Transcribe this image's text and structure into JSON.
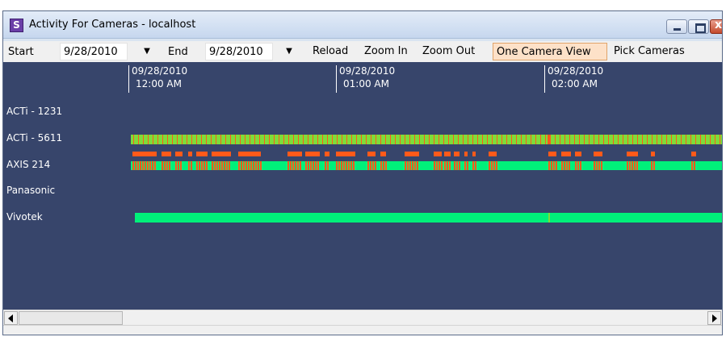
{
  "window": {
    "title": "Activity For Cameras - localhost",
    "app_icon_letter": "S"
  },
  "toolbar": {
    "start_label": "Start",
    "start_date": "9/28/2010",
    "end_label": "End",
    "end_date": "9/28/2010",
    "reload_label": "Reload",
    "zoom_in_label": "Zoom In",
    "zoom_out_label": "Zoom Out",
    "one_camera_view_label": "One Camera View",
    "pick_cameras_label": "Pick Cameras"
  },
  "timeline": {
    "ticks": [
      {
        "date": "09/28/2010",
        "time": "12:00 AM"
      },
      {
        "date": "09/28/2010",
        "time": "01:00 AM"
      },
      {
        "date": "09/28/2010",
        "time": "02:00 AM"
      }
    ],
    "cameras": [
      {
        "name": "ACTi - 1231"
      },
      {
        "name": "ACTi - 5611"
      },
      {
        "name": "AXIS 214"
      },
      {
        "name": "Panasonic"
      },
      {
        "name": "Vivotek"
      }
    ]
  },
  "colors": {
    "background": "#37456b",
    "recording": "#00f07a",
    "motion": "#ff5a1a",
    "continuous_green": "#7fdc3a"
  },
  "icons": {
    "dropdown": "chevron-down-icon",
    "scroll_left": "arrow-left-icon",
    "scroll_right": "arrow-right-icon"
  }
}
